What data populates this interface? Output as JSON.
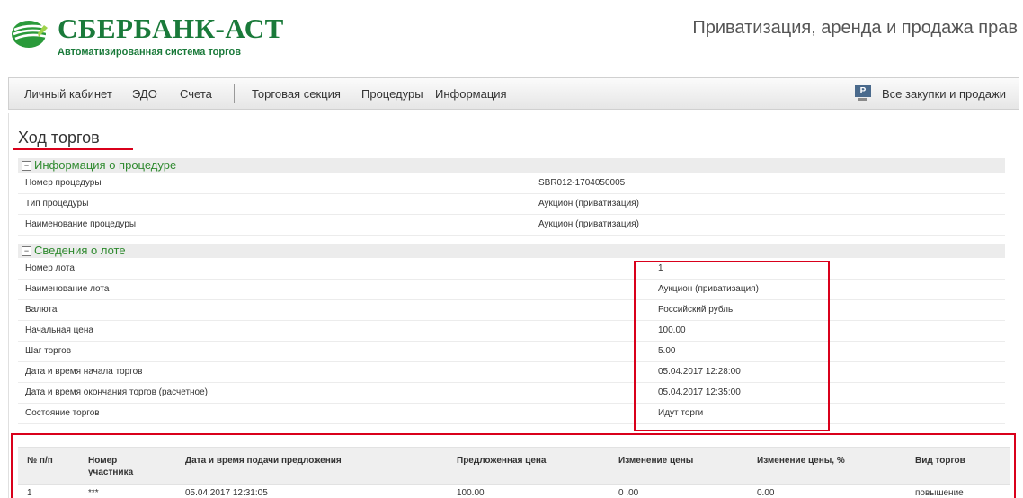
{
  "header": {
    "brand": "СБЕРБАНК-АСТ",
    "brand_subtitle": "Автоматизированная система торгов",
    "section_title": "Приватизация, аренда и продажа прав",
    "logo_icon": "sberbank-logo-icon",
    "brand_color": "#1a7a3a"
  },
  "nav": {
    "items": [
      "Личный кабинет",
      "ЭДО",
      "Счета",
      "Торговая секция",
      "Процедуры",
      "Информация"
    ],
    "right_link": "Все закупки и продажи",
    "right_icon": "presentation-icon",
    "right_icon_letter": "P"
  },
  "page": {
    "title": "Ход торгов",
    "accent_color": "#d9001b"
  },
  "procedure_info": {
    "heading": "Информация о процедуре",
    "toggle": "−",
    "rows": [
      {
        "label": "Номер процедуры",
        "value": "SBR012-1704050005"
      },
      {
        "label": "Тип процедуры",
        "value": "Аукцион (приватизация)"
      },
      {
        "label": "Наименование процедуры",
        "value": "Аукцион (приватизация)"
      }
    ]
  },
  "lot_info": {
    "heading": "Сведения о лоте",
    "toggle": "−",
    "rows": [
      {
        "label": "Номер лота",
        "value": "1"
      },
      {
        "label": "Наименование лота",
        "value": "Аукцион (приватизация)"
      },
      {
        "label": "Валюта",
        "value": "Российский рубль"
      },
      {
        "label": "Начальная цена",
        "value": "100.00"
      },
      {
        "label": "Шаг торгов",
        "value": "5.00"
      },
      {
        "label": "Дата и время начала торгов",
        "value": "05.04.2017 12:28:00"
      },
      {
        "label": "Дата и время окончания торгов (расчетное)",
        "value": "05.04.2017 12:35:00"
      },
      {
        "label": "Состояние торгов",
        "value": "Идут торги"
      }
    ]
  },
  "bids_table": {
    "columns": [
      "№ п/п",
      "Номер участника",
      "Дата и время подачи предложения",
      "Предложенная цена",
      "Изменение цены",
      "Изменение цены, %",
      "Вид торгов"
    ],
    "rows": [
      [
        "1",
        "***",
        "05.04.2017 12:31:05",
        "100.00",
        "0 .00",
        "0.00",
        "повышение"
      ]
    ]
  }
}
